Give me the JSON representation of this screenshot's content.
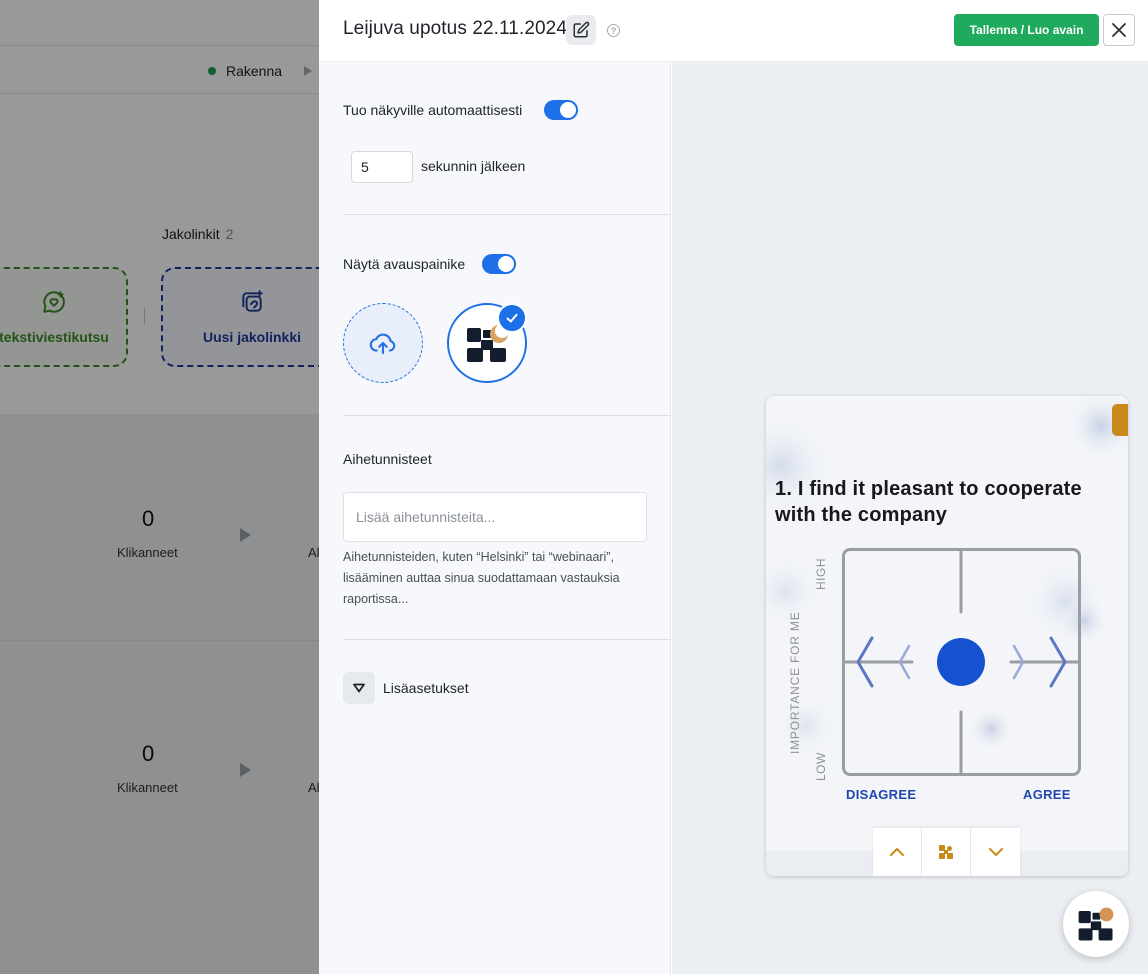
{
  "background": {
    "step_label": "Rakenna",
    "links_title": "Jakolinkit",
    "links_count": "2",
    "card_sms": "tekstiviestikutsu",
    "card_new_link": "Uusi jakolinkki",
    "stats": [
      {
        "value": "0",
        "label": "Klikanneet",
        "cut": "Al"
      },
      {
        "value": "0",
        "label": "Klikanneet",
        "cut": "Al"
      }
    ],
    "colors": {
      "green": "#3d8b2a",
      "blue": "#1e3a9a"
    }
  },
  "header": {
    "title": "Leijuva upotus 22.11.2024",
    "edit_icon": "edit-icon",
    "help_icon": "help-icon",
    "help_glyph": "?",
    "save_label": "Tallenna / Luo avain",
    "close_icon": "close-icon",
    "save_color": "#1faa5d"
  },
  "settings": {
    "auto_show_label": "Tuo näkyville automaattisesti",
    "auto_show_enabled": true,
    "delay_value": "5",
    "delay_suffix": "sekunnin jälkeen",
    "show_button_label": "Näytä avauspainike",
    "show_button_enabled": true,
    "upload_icon": "cloud-upload-icon",
    "selected_logo_icon": "brand-logo-icon",
    "tags_title": "Aihetunnisteet",
    "tags_placeholder": "Lisää aihetunnisteita...",
    "tags_help": "Aihetunnisteiden, kuten “Helsinki” tai “webinaari”, lisääminen auttaa sinua suodattamaan vastauksia raportissa...",
    "advanced_label": "Lisäasetukset",
    "accent_color": "#1d70e8"
  },
  "preview": {
    "question": "1. I find it pleasant to cooperate with the company",
    "axis_high": "HIGH",
    "axis_low": "LOW",
    "axis_y_label": "IMPORTANCE FOR ME",
    "axis_left": "DISAGREE",
    "axis_right": "AGREE",
    "nav_icons": [
      "chevron-up-icon",
      "brand-logo-icon",
      "chevron-down-icon"
    ],
    "colors": {
      "dot": "#1652d0",
      "labels": "#2146ad",
      "orange": "#c98a1c"
    }
  }
}
